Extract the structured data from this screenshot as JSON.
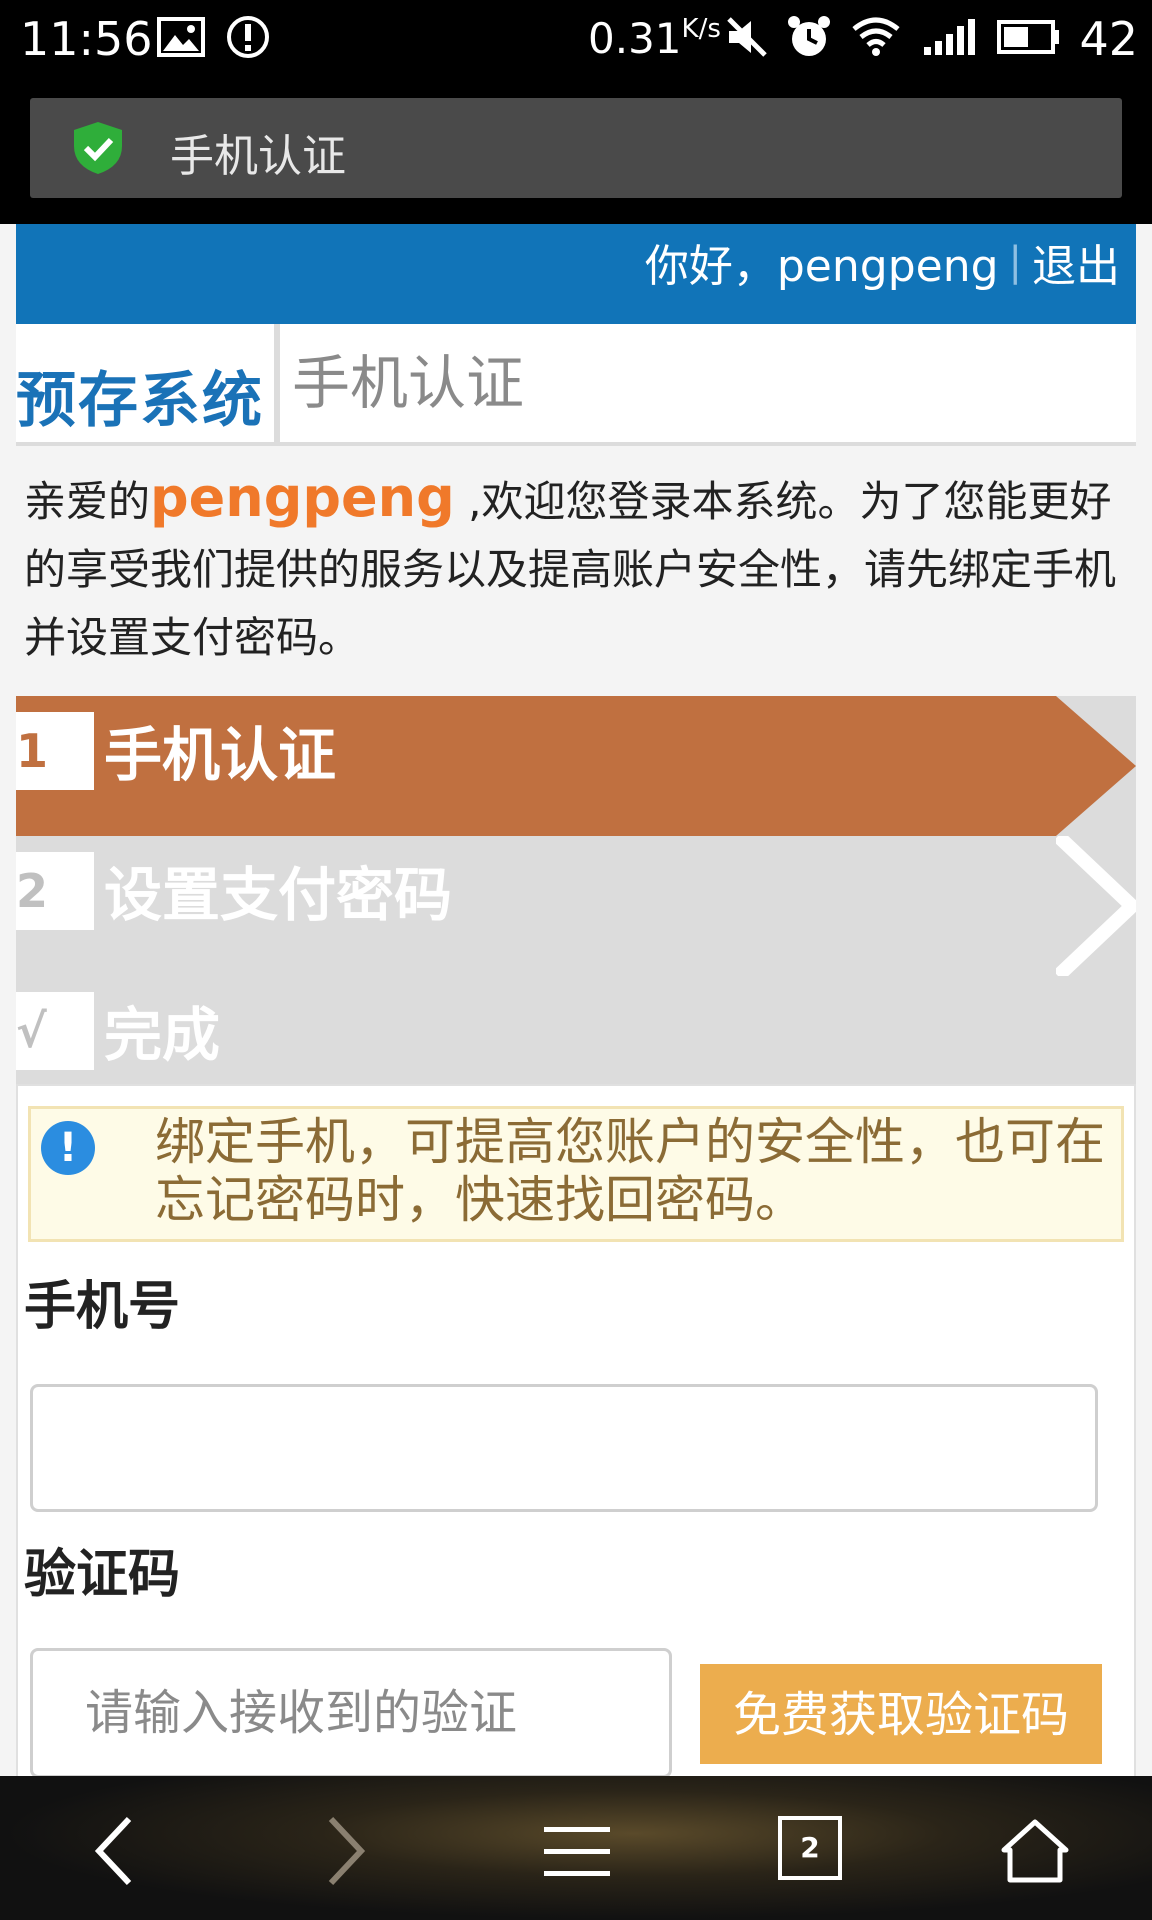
{
  "status_bar": {
    "time": "11:56",
    "network_speed": "0.31",
    "network_speed_unit": "K/s",
    "battery": "42",
    "icons": [
      "image-icon",
      "alert-icon",
      "mute-icon",
      "alarm-icon",
      "wifi-icon",
      "signal-icon",
      "battery-icon"
    ]
  },
  "browser": {
    "title": "手机认证",
    "secure_icon": "shield-check-icon"
  },
  "topbar": {
    "greeting": "你好，pengpeng",
    "separator": "|",
    "logout": "退出"
  },
  "header": {
    "brand": "预存系统",
    "page_name": "手机认证"
  },
  "welcome": {
    "prefix": "亲爱的",
    "username": "pengpeng",
    "suffix": " ,欢迎您登录本系统。为了您能更好的享受我们提供的服务以及提高账户安全性，请先绑定手机并设置支付密码。"
  },
  "steps": [
    {
      "num": "1",
      "label": "手机认证",
      "active": true
    },
    {
      "num": "2",
      "label": "设置支付密码",
      "active": false
    },
    {
      "num": "√",
      "label": "完成",
      "active": false
    }
  ],
  "notice": {
    "text": "绑定手机，可提高您账户的安全性，也可在忘记密码时，快速找回密码。"
  },
  "form": {
    "phone_label": "手机号",
    "phone_value": "",
    "code_label": "验证码",
    "code_placeholder": "请输入接收到的验证",
    "get_code_button": "免费获取验证码"
  },
  "navbar": {
    "tab_count": "2"
  },
  "colors": {
    "topbar": "#1174b8",
    "brand": "#1a72b7",
    "active_step": "#c07040",
    "inactive_step": "#dcdcdc",
    "username": "#f0792a",
    "button": "#ecad4e",
    "notice_bg": "#fefbe7",
    "notice_text": "#8b6b35"
  }
}
